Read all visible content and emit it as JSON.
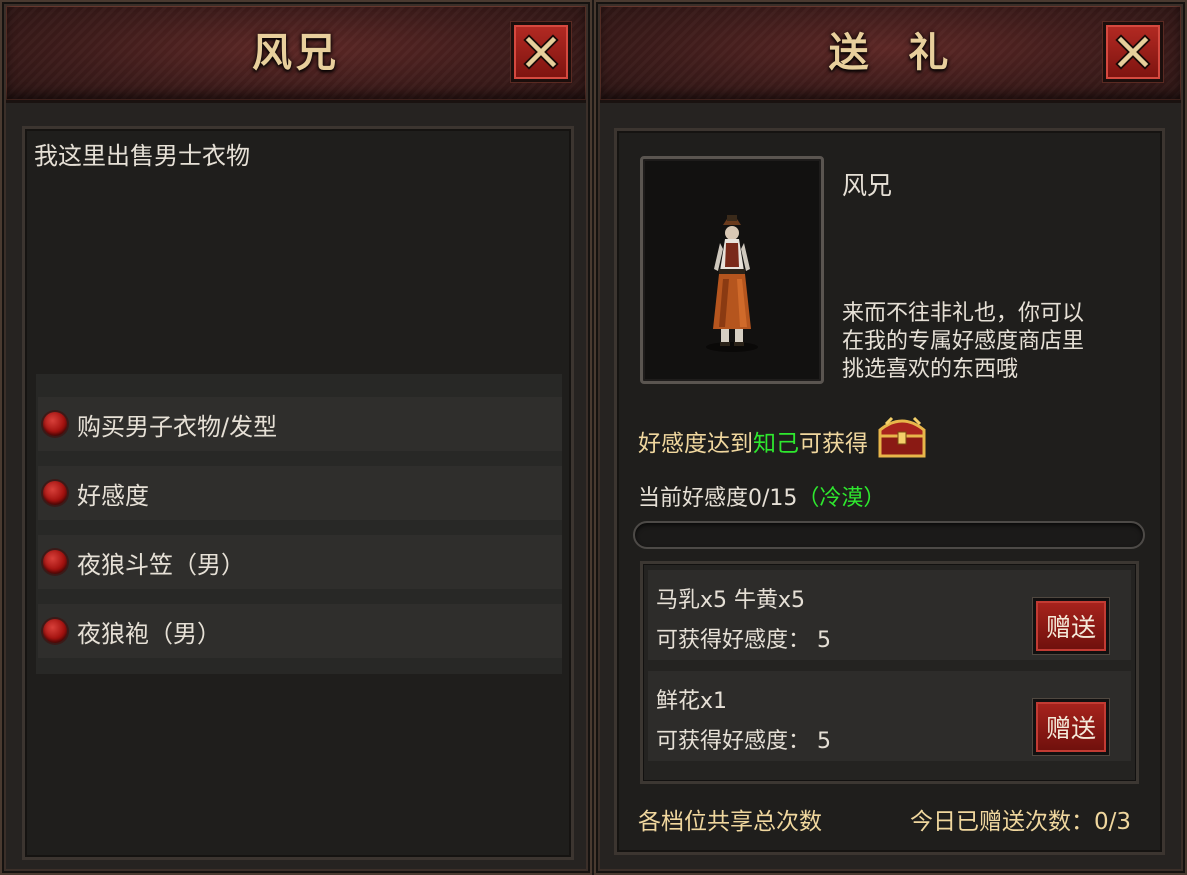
{
  "left": {
    "title": "风兄",
    "description": "我这里出售男士衣物",
    "menu": [
      {
        "label": "购买男子衣物/发型"
      },
      {
        "label": "好感度"
      },
      {
        "label": "夜狼斗笠（男）"
      },
      {
        "label": "夜狼袍（男）"
      }
    ]
  },
  "right": {
    "title": "送  礼",
    "npc_name": "风兄",
    "npc_dialog_lines": [
      "来而不往非礼也，你可以",
      "在我的专属好感度商店里",
      "挑选喜欢的东西哦"
    ],
    "reward_prefix": "好感度达到",
    "reward_level": "知己",
    "reward_suffix": "可获得",
    "current_prefix": "当前好感度",
    "current_value": "0/15",
    "current_status": "（冷漠）",
    "progress_fraction": 0,
    "gifts": [
      {
        "items": "马乳x5 牛黄x5",
        "gain": "可获得好感度： 5",
        "button": "赠送"
      },
      {
        "items": "鲜花x1",
        "gain": "可获得好感度： 5",
        "button": "赠送"
      }
    ],
    "footer_left": "各档位共享总次数",
    "footer_right": "今日已赠送次数：0/3"
  },
  "colors": {
    "text": "#e6e0d6",
    "title_gold": "#e8cf9c",
    "highlight_green": "#2ee82e",
    "button_red": "#a8231d"
  },
  "icons": [
    "close-icon",
    "treasure-chest-icon",
    "menu-bullet-icon"
  ]
}
